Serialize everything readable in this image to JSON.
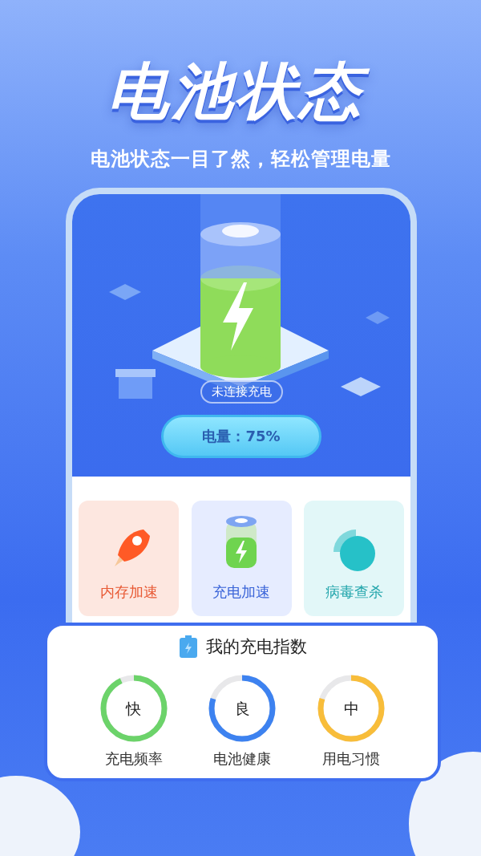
{
  "headline": "电池状态",
  "subtitle": "电池状态一目了然，轻松管理电量",
  "battery": {
    "status": "未连接充电",
    "charge": "电量：75%"
  },
  "tools": [
    {
      "kind": "rocket",
      "label": "内存加速"
    },
    {
      "kind": "battery",
      "label": "充电加速"
    },
    {
      "kind": "shield",
      "label": "病毒查杀"
    }
  ],
  "charge_index": {
    "title": "我的充电指数",
    "meters": [
      {
        "grade": "快",
        "label": "充电频率",
        "level": 0.93,
        "color": "#6cd36a"
      },
      {
        "grade": "良",
        "label": "电池健康",
        "level": 0.8,
        "color": "#3d82f0"
      },
      {
        "grade": "中",
        "label": "用电习惯",
        "level": 0.8,
        "color": "#f8bd3a"
      }
    ]
  }
}
